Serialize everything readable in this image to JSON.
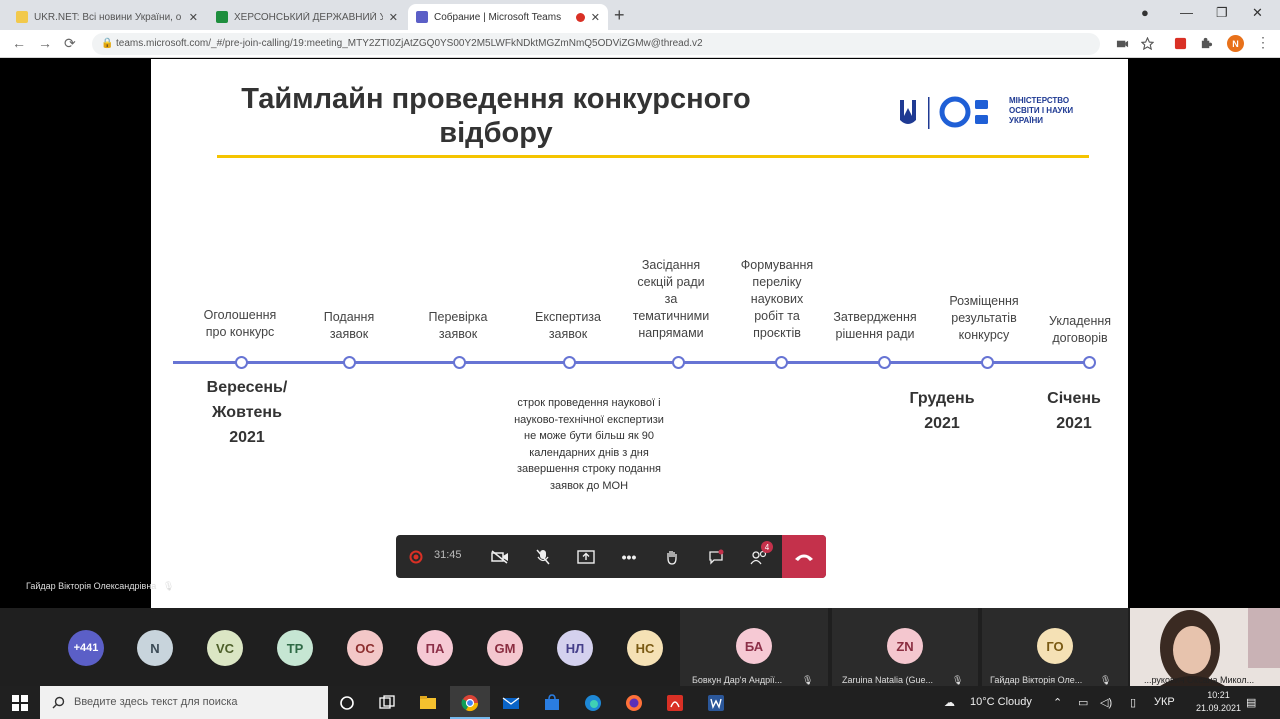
{
  "browser": {
    "tabs": [
      {
        "title": "UKR.NET: Всі новини України, о",
        "active": false,
        "favicon_color": "#f2c94c"
      },
      {
        "title": "ХЕРСОНСЬКИЙ ДЕРЖАВНИЙ УН",
        "active": false,
        "favicon_color": "#1e8e3e"
      },
      {
        "title": "Собрание | Microsoft Teams",
        "active": true,
        "favicon_color": "#5b5fc7"
      }
    ],
    "url": "teams.microsoft.com/_#/pre-join-calling/19:meeting_MTY2ZTI0ZjAtZGQ0YS00Y2M5LWFkNDktMGZmNmQ5ODViZGMw@thread.v2",
    "profile_initial": "N"
  },
  "slide": {
    "title_line1": "Таймлайн проведення конкурсного",
    "title_line2": "відбору",
    "logo_text_line1": "МІНІСТЕРСТВО",
    "logo_text_line2": "ОСВІТИ І НАУКИ",
    "logo_text_line3": "УКРАЇНИ",
    "milestones": [
      {
        "l1": "Оголошення",
        "l2": "про конкурс"
      },
      {
        "l1": "Подання",
        "l2": "заявок"
      },
      {
        "l1": "Перевірка",
        "l2": "заявок"
      },
      {
        "l1": "Експертиза",
        "l2": "заявок"
      },
      {
        "l1": "Засідання",
        "l2": "секцій ради",
        "l3": "за",
        "l4": "тематичними",
        "l5": "напрямами"
      },
      {
        "l1": "Формування",
        "l2": "переліку",
        "l3": "наукових",
        "l4": "робіт та",
        "l5": "проєктів"
      },
      {
        "l1": "Затвердження",
        "l2": "рішення ради"
      },
      {
        "l1": "Розміщення",
        "l2": "результатів",
        "l3": "конкурсу"
      },
      {
        "l1": "Укладення",
        "l2": "договорів"
      }
    ],
    "dates": [
      {
        "l1": "Вересень/",
        "l2": "Жовтень",
        "l3": "2021"
      },
      {
        "l1": "Грудень",
        "l2": "2021"
      },
      {
        "l1": "Січень",
        "l2": "2021"
      }
    ],
    "note_lines": [
      "строк проведення наукової і",
      "науково-технічної експертизи",
      "не може бути більш як 90",
      "календарних днів з дня",
      "завершення строку подання",
      "заявок до МОН"
    ]
  },
  "presenter_name": "Гайдар Вікторія Олександрівна",
  "meeting": {
    "timer": "31:45",
    "chat_badge": "",
    "participants_badge": "4"
  },
  "participants": [
    {
      "initials": "+441",
      "bg": "#5b5fc7",
      "fg": "#ffffff"
    },
    {
      "initials": "N",
      "bg": "#c8d4dc",
      "fg": "#3b4a55"
    },
    {
      "initials": "VC",
      "bg": "#dbe6c4",
      "fg": "#4d5f2a"
    },
    {
      "initials": "TP",
      "bg": "#c6e6d3",
      "fg": "#2f6a46"
    },
    {
      "initials": "ОС",
      "bg": "#f3c7c7",
      "fg": "#8c2f2f"
    },
    {
      "initials": "ПА",
      "bg": "#f6c9d4",
      "fg": "#8c2f48"
    },
    {
      "initials": "GM",
      "bg": "#f4c7cf",
      "fg": "#8a2d40"
    },
    {
      "initials": "НЛ",
      "bg": "#d4d1ee",
      "fg": "#453f8a"
    },
    {
      "initials": "НС",
      "bg": "#f5e1b5",
      "fg": "#7a5a14"
    }
  ],
  "named_participants": [
    {
      "initials": "БА",
      "name": "Бовкун Дар'я Андрії...",
      "bg": "#f6c9d4",
      "fg": "#8c2f48"
    },
    {
      "initials": "ZN",
      "name": "Zaruina Natalia (Gue...",
      "bg": "#f4c7cf",
      "fg": "#8a2d40"
    },
    {
      "initials": "ГО",
      "name": "Гайдар Вікторія Оле...",
      "bg": "#f5e1b5",
      "fg": "#7a5a14"
    }
  ],
  "self_view_name": "...рукович Оксана Микол...",
  "taskbar": {
    "search_placeholder": "Введите здесь текст для поиска",
    "weather": "10°C  Cloudy",
    "lang": "УКР",
    "time": "10:21",
    "date": "21.09.2021"
  }
}
